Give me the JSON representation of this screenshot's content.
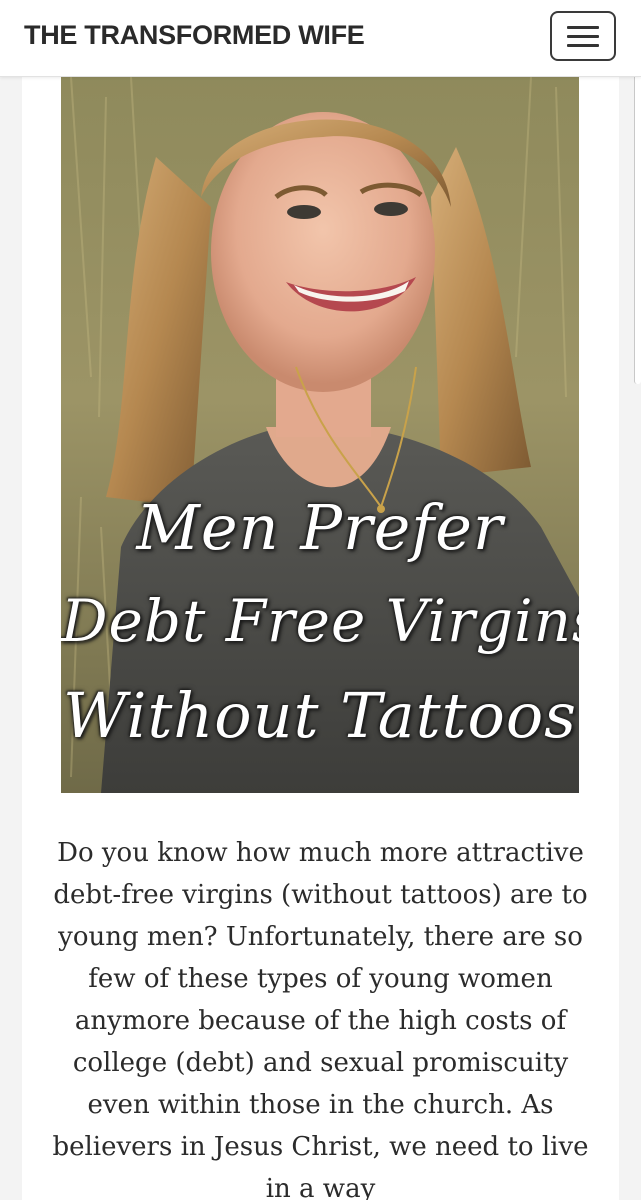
{
  "header": {
    "site_title": "THE TRANSFORMED WIFE",
    "menu_icon": "hamburger-menu-icon"
  },
  "post": {
    "featured_image": {
      "caption_lines": [
        "Men Prefer",
        "Debt Free Virgins",
        "Without Tattoos"
      ]
    },
    "intro_text": "Do you know how much more attractive debt-free virgins (without tattoos) are to young men? Unfortunately, there are so few of these types of young women anymore because of the high costs of college (debt) and sexual promiscuity even within those in the church. As believers in Jesus Christ, we need to live in a way"
  },
  "colors": {
    "header_bg": "#ffffff",
    "page_bg": "#f3f3f3",
    "text": "#2b2b2b",
    "title": "#2a2a2a"
  }
}
